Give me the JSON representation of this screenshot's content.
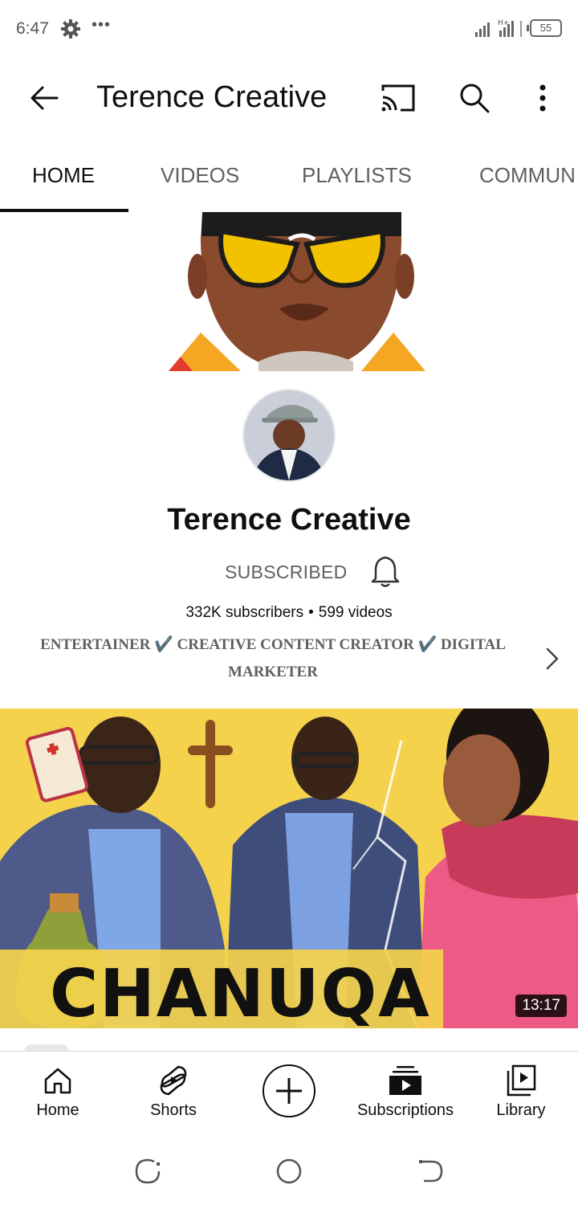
{
  "status_bar": {
    "time": "6:47",
    "dots": "•••",
    "battery": "55",
    "icons": [
      "gear-icon",
      "signal-icon",
      "battery-icon"
    ]
  },
  "app_bar": {
    "title": "Terence Creative",
    "icons": [
      "back-arrow-icon",
      "cast-icon",
      "search-icon",
      "more-vertical-icon"
    ]
  },
  "tabs": [
    {
      "label": "HOME",
      "active": true
    },
    {
      "label": "VIDEOS",
      "active": false
    },
    {
      "label": "PLAYLISTS",
      "active": false
    },
    {
      "label": "COMMUN",
      "active": false
    }
  ],
  "channel": {
    "name": "Terence Creative",
    "subscribe_label": "SUBSCRIBED",
    "subscribers": "332K subscribers",
    "separator": "•",
    "videos": "599 videos",
    "description_line1": "ENTERTAINER ✔️ CREATIVE CONTENT CREATOR ✔️ DIGITAL",
    "description_line2": "MARKETER"
  },
  "featured_video": {
    "caption": "CHANUQA",
    "duration": "13:17"
  },
  "bottom_nav": {
    "home": "Home",
    "shorts": "Shorts",
    "subscriptions": "Subscriptions",
    "library": "Library"
  },
  "colors": {
    "text_primary": "#0f0f0f",
    "text_secondary": "#606060",
    "thumb_background": "#f4d24c",
    "banner_glasses": "#f2c200"
  }
}
